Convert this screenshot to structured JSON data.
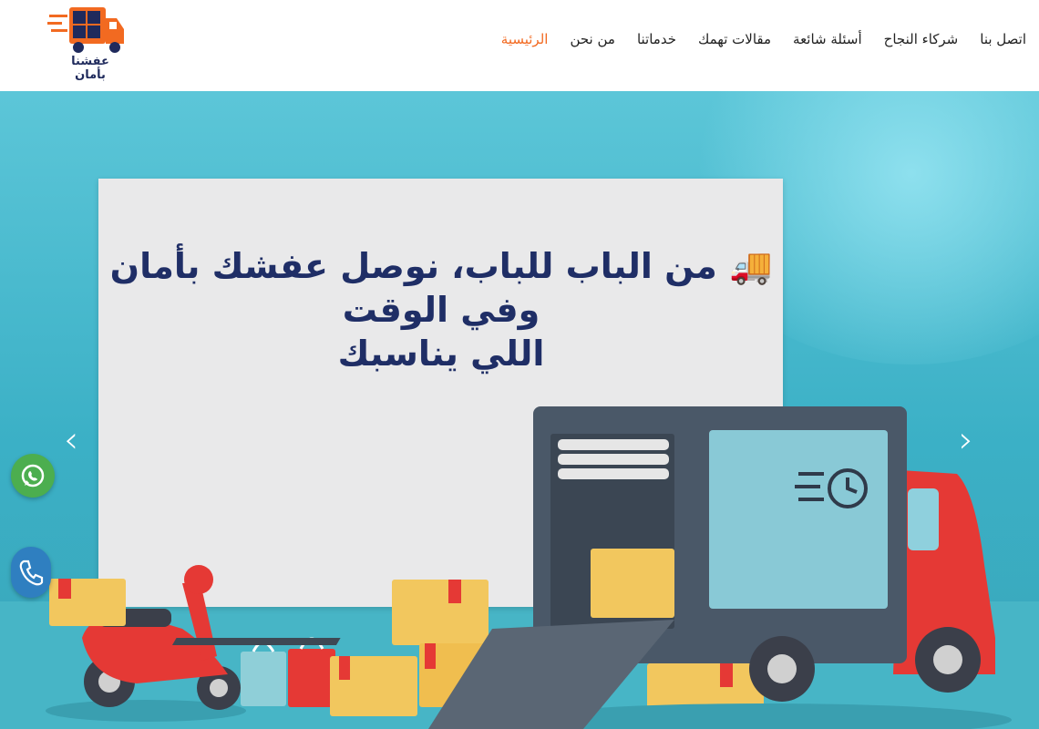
{
  "logo": {
    "text": "عفشنا بأمان",
    "icon": "moving-truck-logo-icon"
  },
  "nav": {
    "items": [
      {
        "label": "الرئيسية",
        "active": true
      },
      {
        "label": "من نحن",
        "active": false
      },
      {
        "label": "خدماتنا",
        "active": false
      },
      {
        "label": "مقالات تهمك",
        "active": false
      },
      {
        "label": "أسئلة شائعة",
        "active": false
      },
      {
        "label": "شركاء النجاح",
        "active": false
      },
      {
        "label": "اتصل بنا",
        "active": false
      }
    ]
  },
  "hero": {
    "title_line1": "🚚 من الباب للباب، نوصل عفشك بأمان وفي الوقت",
    "title_line2": "اللي يناسبك",
    "prev_icon": "chevron-left-icon",
    "next_icon": "chevron-right-icon"
  },
  "floating": {
    "whatsapp_icon": "whatsapp-icon",
    "phone_icon": "phone-icon"
  },
  "colors": {
    "accent": "#f26a21",
    "title": "#1f2e66",
    "hero_bg": "#4bb7cb",
    "whatsapp": "#4cae4f",
    "phone": "#2f7fc0"
  }
}
